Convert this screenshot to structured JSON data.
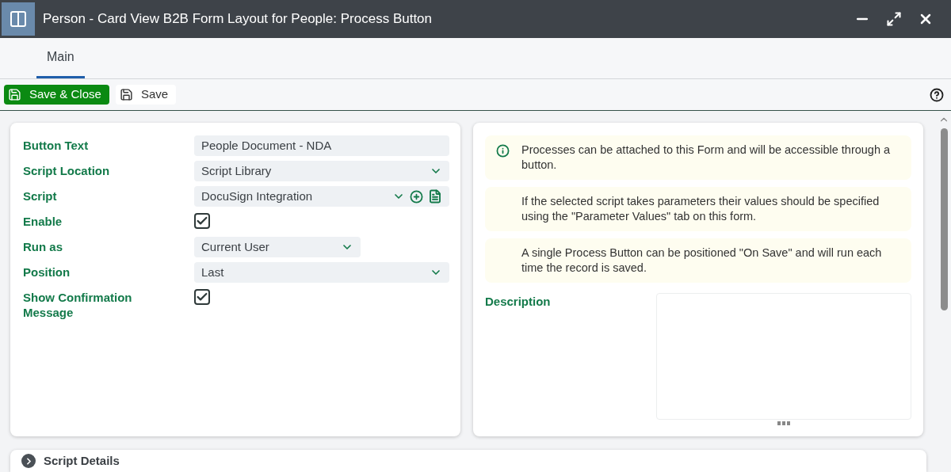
{
  "window": {
    "title": "Person - Card View B2B Form Layout for People: Process Button"
  },
  "tabs": [
    {
      "label": "Main",
      "selected": true
    }
  ],
  "toolbar": {
    "buttons": [
      {
        "label": "Save & Close",
        "kind": "primary"
      },
      {
        "label": "Save",
        "kind": "secondary"
      }
    ]
  },
  "form": {
    "fields": [
      {
        "label": "Button Text",
        "kind": "text",
        "value": "People Document - NDA"
      },
      {
        "label": "Script Location",
        "kind": "select",
        "value": "Script Library"
      },
      {
        "label": "Script",
        "kind": "select_actions",
        "value": "DocuSign Integration"
      },
      {
        "label": "Enable",
        "kind": "checkbox",
        "checked": true
      },
      {
        "label": "Run as",
        "kind": "select_short",
        "value": "Current User"
      },
      {
        "label": "Position",
        "kind": "select",
        "value": "Last"
      },
      {
        "label": "Show Confirmation Message",
        "kind": "checkbox",
        "checked": true
      }
    ]
  },
  "notes": [
    {
      "text": "Processes can be attached to this Form and will be accessible through a button.",
      "icon": true
    },
    {
      "text": "If the selected script takes parameters their values should be specified using the \"Parameter Values\" tab on this form.",
      "icon": false
    },
    {
      "text": "A single Process Button can be positioned \"On Save\" and will run each time the record is saved.",
      "icon": false
    }
  ],
  "description": {
    "label": "Description"
  },
  "sections": [
    {
      "title": "Script Details",
      "expanded": false
    }
  ]
}
